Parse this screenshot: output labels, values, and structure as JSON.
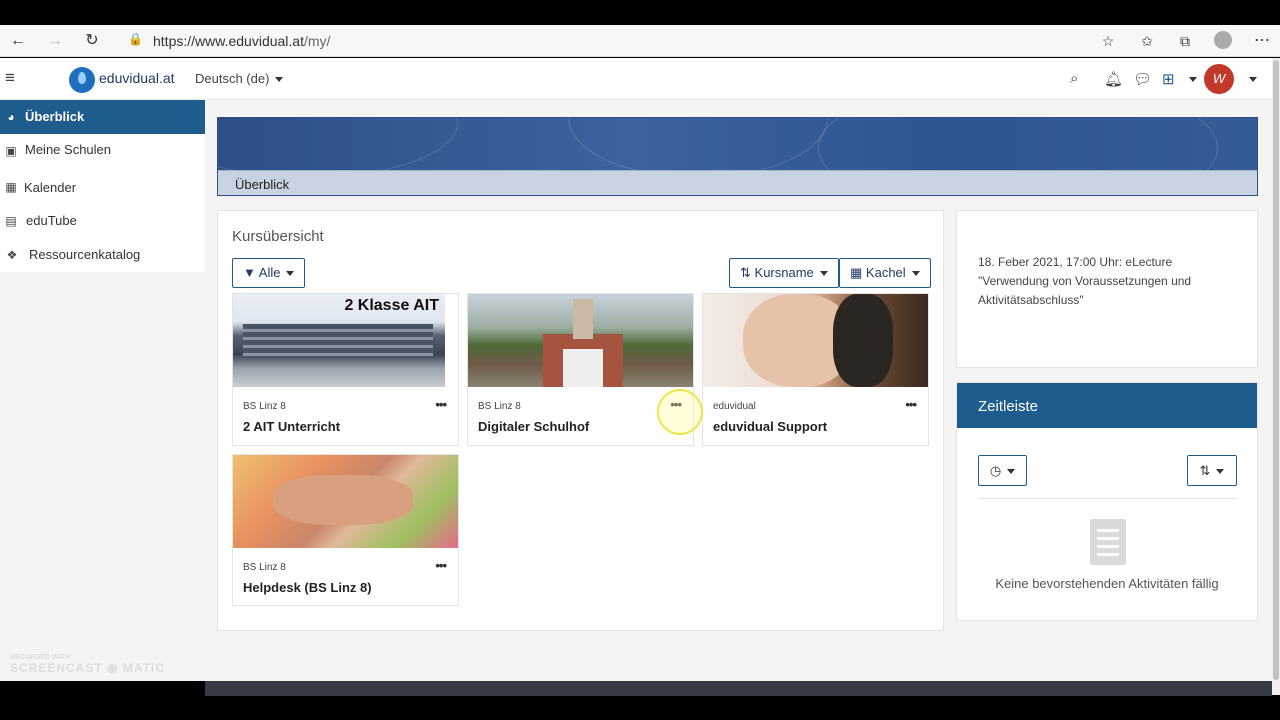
{
  "browser": {
    "url_main": "https://www.eduvidual.at",
    "url_path": "/my/"
  },
  "navbar": {
    "brand": "eduvidual.at",
    "language": "Deutsch (de)",
    "avatar_text": "W"
  },
  "sidebar": {
    "items": [
      {
        "label": "Überblick",
        "icon": "dashboard-icon"
      },
      {
        "label": "Meine Schulen",
        "icon": "school-icon"
      },
      {
        "label": "Kalender",
        "icon": "calendar-icon"
      },
      {
        "label": "eduTube",
        "icon": "film-icon"
      },
      {
        "label": "Ressourcenkatalog",
        "icon": "cubes-icon"
      }
    ]
  },
  "hero": {
    "label": "Überblick"
  },
  "kurs": {
    "title": "Kursübersicht",
    "filter_label": "Alle",
    "sort_label": "Kursname",
    "view_label": "Kachel",
    "courses": [
      {
        "category": "BS Linz 8",
        "name": "2 AIT Unterricht",
        "image_text": "2 Klasse AIT"
      },
      {
        "category": "BS Linz 8",
        "name": "Digitaler Schulhof",
        "image_text": ""
      },
      {
        "category": "eduvidual",
        "name": "eduvidual Support",
        "image_text": ""
      },
      {
        "category": "BS Linz 8",
        "name": "Helpdesk (BS Linz 8)",
        "image_text": ""
      }
    ]
  },
  "event": {
    "text": "18. Feber 2021, 17:00 Uhr: eLecture \"Verwendung von Voraussetzungen und Aktivitätsabschluss\""
  },
  "zeitleiste": {
    "title": "Zeitleiste",
    "empty_text": "Keine bevorstehenden Aktivitäten fällig"
  },
  "watermark": {
    "line1": "RECORDED WITH",
    "line2": "SCREENCAST",
    "line3": "MATIC"
  }
}
